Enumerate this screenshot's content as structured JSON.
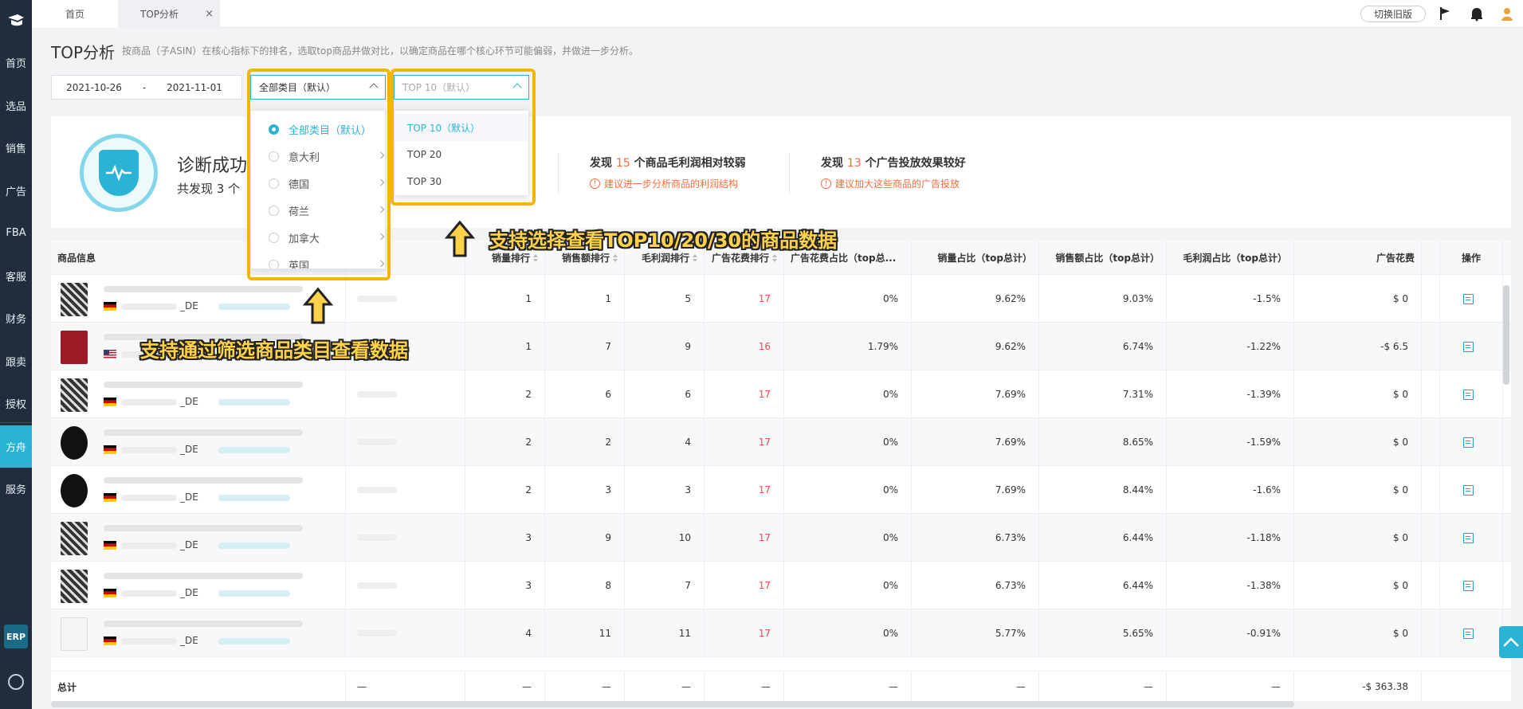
{
  "sidebar": {
    "items": [
      {
        "label": "首页"
      },
      {
        "label": "选品"
      },
      {
        "label": "销售"
      },
      {
        "label": "广告"
      },
      {
        "label": "FBA"
      },
      {
        "label": "客服"
      },
      {
        "label": "财务"
      },
      {
        "label": "跟卖"
      },
      {
        "label": "授权"
      },
      {
        "label": "方舟"
      },
      {
        "label": "服务"
      }
    ],
    "active_index": 9,
    "erp_label": "ERP"
  },
  "topbar": {
    "tabs": [
      {
        "label": "首页"
      },
      {
        "label": "TOP分析"
      }
    ],
    "close_glyph": "×",
    "switch_label": "切换旧版"
  },
  "page": {
    "title": "TOP分析",
    "description": "按商品（子ASIN）在核心指标下的排名，选取top商品并做对比，以确定商品在哪个核心环节可能偏弱，并做进一步分析。"
  },
  "filters": {
    "date_start": "2021-10-26",
    "date_sep": "-",
    "date_end": "2021-11-01",
    "category_value": "全部类目（默认）",
    "top_value": "TOP 10（默认）"
  },
  "category_dropdown": {
    "options": [
      {
        "label": "全部类目（默认）"
      },
      {
        "label": "意大利"
      },
      {
        "label": "德国"
      },
      {
        "label": "荷兰"
      },
      {
        "label": "加拿大"
      },
      {
        "label": "英国"
      }
    ],
    "selected": 0
  },
  "top_dropdown": {
    "options": [
      {
        "label": "TOP 10（默认）"
      },
      {
        "label": "TOP 20"
      },
      {
        "label": "TOP 30"
      }
    ],
    "selected": 0
  },
  "diagnosis": {
    "title": "诊断成功",
    "subtitle_prefix": "共发现 3 个",
    "findings": [
      {
        "pre": "发现 ",
        "num": "15",
        "post": " 个商品毛利润相对较弱",
        "suggestion": "建议进一步分析商品的利润结构"
      },
      {
        "pre": "发现 ",
        "num": "13",
        "post": " 个广告投放效果较好",
        "suggestion": "建议加大这些商品的广告投放"
      }
    ],
    "warn_glyph": "!"
  },
  "table": {
    "headers": {
      "product": "商品信息",
      "sales_rank": "销量排行",
      "revenue_rank": "销售额排行",
      "profit_rank": "毛利润排行",
      "ad_rank": "广告花费排行",
      "ad_share": "广告花费占比（top总...",
      "sales_share": "销量占比（top总计）",
      "revenue_share": "销售额占比（top总计）",
      "profit_share": "毛利润占比（top总计）",
      "ad_spend": "广告花费",
      "op": "操作"
    },
    "rows": [
      {
        "market": "_DE",
        "flag": "de",
        "r1": "1",
        "r2": "1",
        "r3": "5",
        "r4": "17",
        "ad_share": "0%",
        "sales_share": "9.62%",
        "rev_share": "9.03%",
        "profit_share": "-1.5%",
        "ad_spend": "$ 0"
      },
      {
        "market": "",
        "flag": "us",
        "r1": "1",
        "r2": "7",
        "r3": "9",
        "r4": "16",
        "ad_share": "1.79%",
        "sales_share": "9.62%",
        "rev_share": "6.74%",
        "profit_share": "-1.22%",
        "ad_spend": "-$ 6.5"
      },
      {
        "market": "_DE",
        "flag": "de",
        "r1": "2",
        "r2": "6",
        "r3": "6",
        "r4": "17",
        "ad_share": "0%",
        "sales_share": "7.69%",
        "rev_share": "7.31%",
        "profit_share": "-1.39%",
        "ad_spend": "$ 0"
      },
      {
        "market": "_DE",
        "flag": "de",
        "r1": "2",
        "r2": "2",
        "r3": "4",
        "r4": "17",
        "ad_share": "0%",
        "sales_share": "7.69%",
        "rev_share": "8.65%",
        "profit_share": "-1.59%",
        "ad_spend": "$ 0"
      },
      {
        "market": "_DE",
        "flag": "de",
        "r1": "2",
        "r2": "3",
        "r3": "3",
        "r4": "17",
        "ad_share": "0%",
        "sales_share": "7.69%",
        "rev_share": "8.44%",
        "profit_share": "-1.6%",
        "ad_spend": "$ 0"
      },
      {
        "market": "_DE",
        "flag": "de",
        "r1": "3",
        "r2": "9",
        "r3": "10",
        "r4": "17",
        "ad_share": "0%",
        "sales_share": "6.73%",
        "rev_share": "6.44%",
        "profit_share": "-1.18%",
        "ad_spend": "$ 0"
      },
      {
        "market": "_DE",
        "flag": "de",
        "r1": "3",
        "r2": "8",
        "r3": "7",
        "r4": "17",
        "ad_share": "0%",
        "sales_share": "6.73%",
        "rev_share": "6.44%",
        "profit_share": "-1.38%",
        "ad_spend": "$ 0"
      },
      {
        "market": "_DE",
        "flag": "de",
        "r1": "4",
        "r2": "11",
        "r3": "11",
        "r4": "17",
        "ad_share": "0%",
        "sales_share": "5.77%",
        "rev_share": "5.65%",
        "profit_share": "-0.91%",
        "ad_spend": "$ 0"
      }
    ],
    "total": {
      "label": "总计",
      "dash": "—",
      "ad_spend": "-$ 363.38"
    }
  },
  "annotations": {
    "top_callout": "支持选择查看TOP10/20/30的商品数据",
    "category_callout": "支持通过筛选商品类目查看数据"
  },
  "colors": {
    "accent": "#2bb3d5",
    "highlight": "#f5b400",
    "warning": "#f56c3a",
    "rank_red": "#f04b4b",
    "sidebar_bg": "#1f2d3d"
  }
}
